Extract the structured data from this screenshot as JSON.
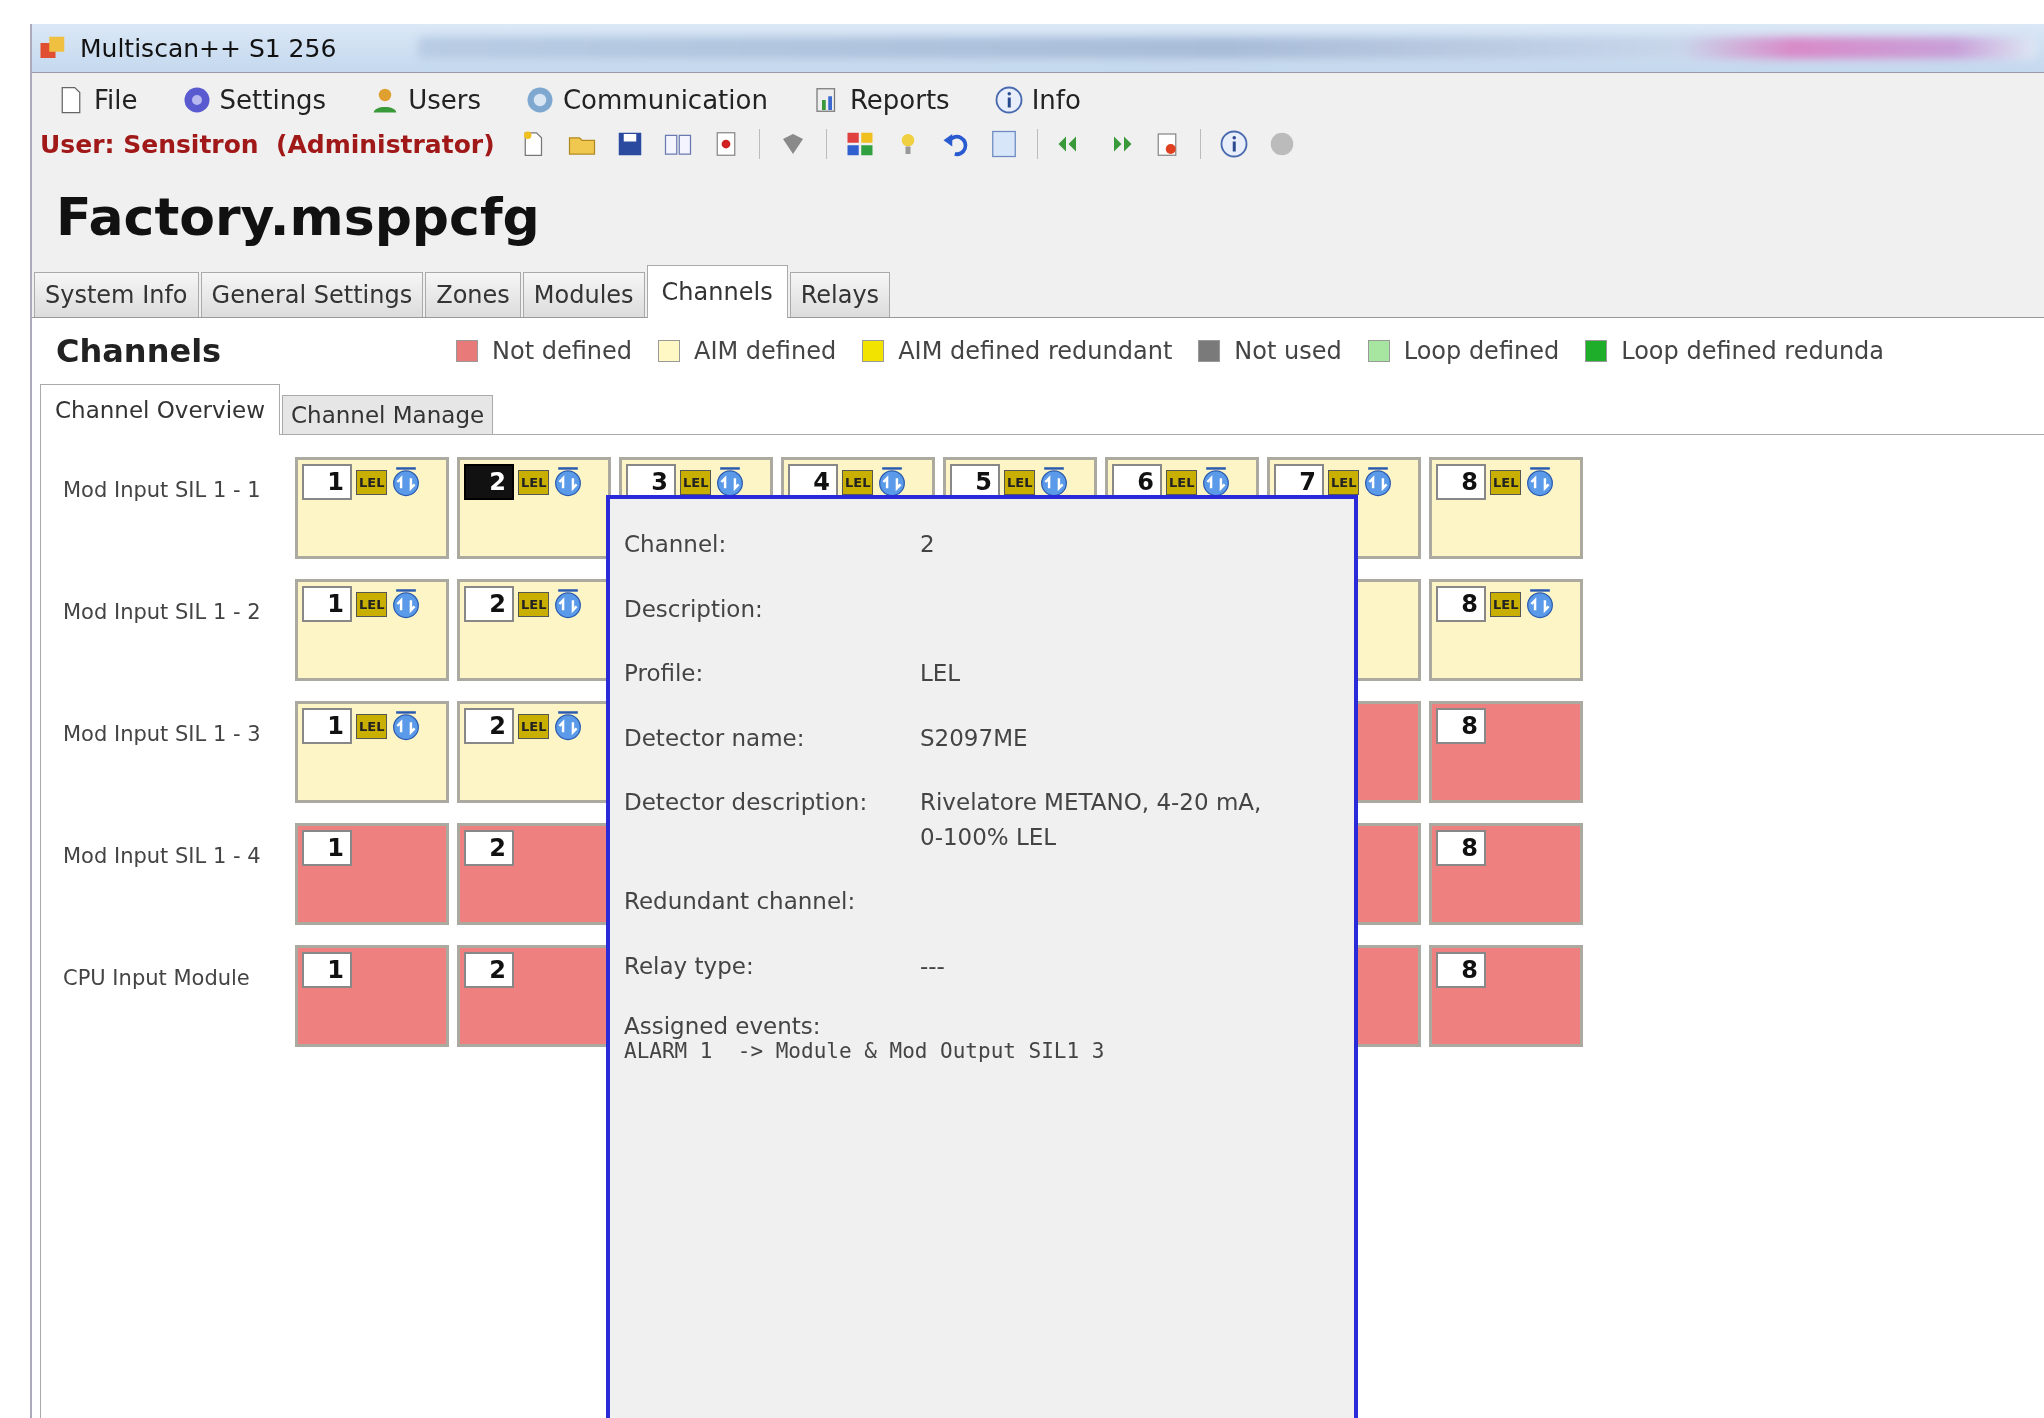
{
  "window": {
    "title": "Multiscan++ S1 256"
  },
  "menu": [
    {
      "label": "File"
    },
    {
      "label": "Settings"
    },
    {
      "label": "Users"
    },
    {
      "label": "Communication"
    },
    {
      "label": "Reports"
    },
    {
      "label": "Info"
    }
  ],
  "user_label": "User: Sensitron  (Administrator)",
  "document_title": "Factory.msppcfg",
  "tabs": [
    {
      "label": "System Info",
      "selected": false
    },
    {
      "label": "General Settings",
      "selected": false
    },
    {
      "label": "Zones",
      "selected": false
    },
    {
      "label": "Modules",
      "selected": false
    },
    {
      "label": "Channels",
      "selected": true
    },
    {
      "label": "Relays",
      "selected": false
    }
  ],
  "section_title": "Channels",
  "legend": [
    {
      "label": "Not defined",
      "color": "#e87a7a"
    },
    {
      "label": "AIM defined",
      "color": "#fff7c4"
    },
    {
      "label": "AIM defined redundant",
      "color": "#f2e400"
    },
    {
      "label": "Not used",
      "color": "#7a7a7a"
    },
    {
      "label": "Loop defined",
      "color": "#a6e6a0"
    },
    {
      "label": "Loop defined redunda",
      "color": "#1fae2a"
    }
  ],
  "subtabs": [
    {
      "label": "Channel Overview",
      "selected": true
    },
    {
      "label": "Channel Manage",
      "selected": false
    }
  ],
  "rows": [
    {
      "label": "Mod Input SIL 1 - 1",
      "cells": [
        {
          "number": "1",
          "color": "#fdf5c6",
          "profile": "LEL",
          "selected": false
        },
        {
          "number": "2",
          "color": "#fdf5c6",
          "profile": "LEL",
          "selected": true
        },
        {
          "number": "3",
          "color": "#fdf5c6",
          "profile": "LEL",
          "selected": false
        },
        {
          "number": "4",
          "color": "#fdf5c6",
          "profile": "LEL",
          "selected": false
        },
        {
          "number": "5",
          "color": "#fdf5c6",
          "profile": "LEL",
          "selected": false
        },
        {
          "number": "6",
          "color": "#fdf5c6",
          "profile": "LEL",
          "selected": false
        },
        {
          "number": "7",
          "color": "#fdf5c6",
          "profile": "LEL",
          "selected": false
        },
        {
          "number": "8",
          "color": "#fdf5c6",
          "profile": "LEL",
          "selected": false
        }
      ]
    },
    {
      "label": "Mod Input SIL 1 - 2",
      "cells": [
        {
          "number": "1",
          "color": "#fdf5c6",
          "profile": "LEL",
          "selected": false
        },
        {
          "number": "2",
          "color": "#fdf5c6",
          "profile": "LEL",
          "selected": false
        },
        null,
        null,
        null,
        null,
        {
          "color": "#fdf5c6"
        },
        {
          "number": "8",
          "color": "#fdf5c6",
          "profile": "LEL",
          "selected": false
        }
      ]
    },
    {
      "label": "Mod Input SIL 1 - 3",
      "cells": [
        {
          "number": "1",
          "color": "#fdf5c6",
          "profile": "LEL",
          "selected": false
        },
        {
          "number": "2",
          "color": "#fdf5c6",
          "profile": "LEL",
          "selected": false
        },
        null,
        null,
        null,
        null,
        {
          "color": "#ee8080"
        },
        {
          "number": "8",
          "color": "#ee8080",
          "selected": false
        }
      ]
    },
    {
      "label": "Mod Input SIL 1 - 4",
      "cells": [
        {
          "number": "1",
          "color": "#ee8080",
          "selected": false
        },
        {
          "number": "2",
          "color": "#ee8080",
          "selected": false
        },
        null,
        null,
        null,
        null,
        {
          "color": "#ee8080"
        },
        {
          "number": "8",
          "color": "#ee8080",
          "selected": false
        }
      ]
    },
    {
      "label": "CPU Input Module",
      "cells": [
        {
          "number": "1",
          "color": "#ee8080",
          "selected": false
        },
        {
          "number": "2",
          "color": "#ee8080",
          "selected": false
        },
        null,
        null,
        null,
        null,
        {
          "color": "#ee8080"
        },
        {
          "number": "8",
          "color": "#ee8080",
          "selected": false
        }
      ]
    }
  ],
  "tooltip": {
    "fields": [
      {
        "label": "Channel:",
        "value": "2"
      },
      {
        "label": "Description:"
      },
      {
        "label": "Profile:",
        "value": "LEL"
      },
      {
        "label": "Detector name:",
        "value": "S2097ME"
      },
      {
        "label": "Detector description:",
        "value": "Rivelatore METANO, 4-20 mA, 0-100% LEL"
      },
      {
        "label": "Redundant channel:"
      },
      {
        "label": "Relay type:",
        "value": "---"
      }
    ],
    "events_label": "Assigned events:",
    "events": [
      "ALARM 1  -> Module & Mod Output SIL1 3"
    ]
  }
}
